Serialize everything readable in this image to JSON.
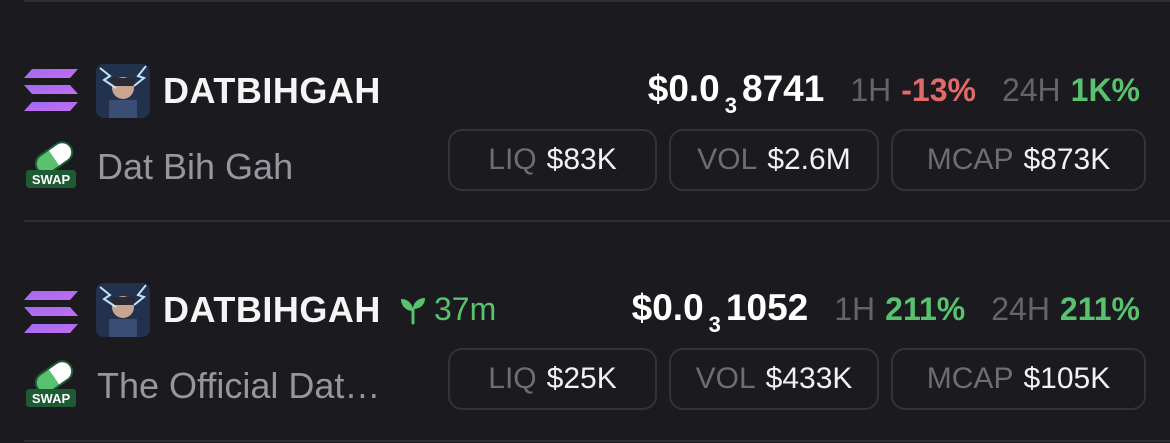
{
  "tokens": [
    {
      "symbol": "DATBIHGAH",
      "name": "Dat Bih Gah",
      "age": "",
      "price_prefix": "$0.0",
      "price_zeros": "3",
      "price_digits": "8741",
      "change_1h_label": "1H",
      "change_1h": "-13%",
      "change_24h_label": "24H",
      "change_24h": "1K%",
      "liq_label": "LIQ",
      "liq": "$83K",
      "vol_label": "VOL",
      "vol": "$2.6M",
      "mcap_label": "MCAP",
      "mcap": "$873K",
      "swap_badge": "SWAP"
    },
    {
      "symbol": "DATBIHGAH",
      "name": "The Official Dat…",
      "age": "37m",
      "price_prefix": "$0.0",
      "price_zeros": "3",
      "price_digits": "1052",
      "change_1h_label": "1H",
      "change_1h": "211%",
      "change_24h_label": "24H",
      "change_24h": "211%",
      "liq_label": "LIQ",
      "liq": "$25K",
      "vol_label": "VOL",
      "vol": "$433K",
      "mcap_label": "MCAP",
      "mcap": "$105K",
      "swap_badge": "SWAP"
    }
  ],
  "icons": {
    "chain": "solana-icon",
    "dex": "pump-swap-icon",
    "age": "sprout-icon"
  },
  "colors": {
    "positive": "#58c26e",
    "negative": "#e36a6a",
    "background": "#1b1a1e"
  }
}
